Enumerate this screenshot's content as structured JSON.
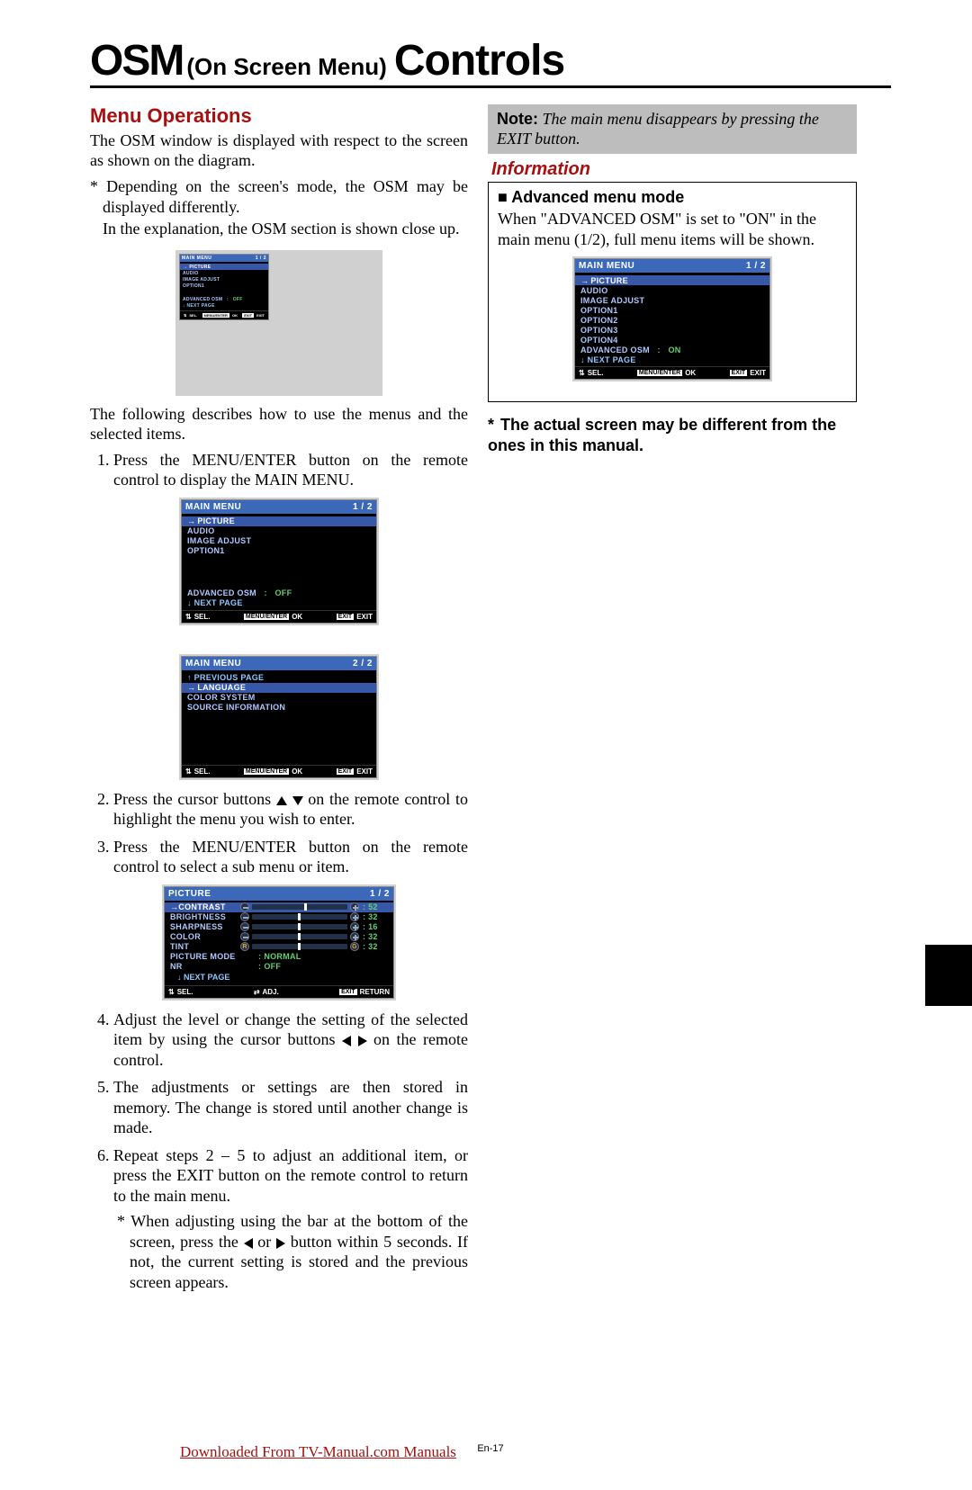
{
  "header": {
    "osm": "OSM",
    "sub": "(On Screen Menu)",
    "controls": "Controls"
  },
  "left": {
    "menu_ops_h": "Menu Operations",
    "intro": "The OSM window is displayed with respect to the screen as shown on the diagram.",
    "asterisk1": "Depending on the screen's mode, the OSM may be displayed differently.",
    "asterisk1b": "In the explanation, the OSM section is shown close up.",
    "after_small": "The following describes how to use the menus and the selected items.",
    "step1": "Press the MENU/ENTER button on the remote control to display the MAIN MENU.",
    "step2": "Press the cursor buttons ▲ ▼ on the remote control to highlight the menu you wish to enter.",
    "step3": "Press the MENU/ENTER button on the remote control to select a sub menu or item.",
    "step4": "Adjust the level or change the setting of the selected item by using the cursor buttons ◀ ▶ on the remote control.",
    "step5": "The adjustments or settings are then stored in memory. The change is stored until another change is made.",
    "step6": "Repeat steps 2 – 5 to adjust an additional item, or press the EXIT button on the remote control to return to the main menu.",
    "substep": "When adjusting using the bar at the bottom of the screen, press the ◀ or ▶ button within 5 seconds. If not, the current setting is stored and the previous screen appears."
  },
  "right": {
    "note_label": "Note:",
    "note_text": " The main menu disappears by pressing the EXIT button.",
    "info_h": "Information",
    "adv_h": "Advanced menu mode",
    "adv_body": "When \"ADVANCED OSM\" is set to \"ON\" in the main menu (1/2), full menu items will be shown.",
    "actual_note": "The actual screen may be different from the ones in this manual."
  },
  "osm_main_1": {
    "title": "MAIN MENU",
    "page": "1 / 2",
    "items": [
      "PICTURE",
      "AUDIO",
      "IMAGE ADJUST",
      "OPTION1"
    ],
    "adv": "ADVANCED OSM",
    "adv_val": "OFF",
    "next": "↓ NEXT PAGE",
    "f_sel": "SEL.",
    "f_ok": "OK",
    "f_okbtn": "MENU/ENTER",
    "f_ex": "EXIT",
    "f_exbtn": "EXIT"
  },
  "osm_main_2": {
    "title": "MAIN MENU",
    "page": "2 / 2",
    "prev": "↑ PREVIOUS PAGE",
    "items": [
      "LANGUAGE",
      "COLOR SYSTEM",
      "SOURCE INFORMATION"
    ],
    "f_sel": "SEL.",
    "f_ok": "OK",
    "f_okbtn": "MENU/ENTER",
    "f_ex": "EXIT",
    "f_exbtn": "EXIT"
  },
  "osm_adv": {
    "title": "MAIN MENU",
    "page": "1 / 2",
    "items": [
      "PICTURE",
      "AUDIO",
      "IMAGE ADJUST",
      "OPTION1",
      "OPTION2",
      "OPTION3",
      "OPTION4"
    ],
    "adv": "ADVANCED OSM",
    "adv_val": "ON",
    "next": "↓ NEXT PAGE",
    "f_sel": "SEL.",
    "f_ok": "OK",
    "f_okbtn": "MENU/ENTER",
    "f_ex": "EXIT",
    "f_exbtn": "EXIT"
  },
  "osm_picture": {
    "title": "PICTURE",
    "page": "1 / 2",
    "rows": [
      {
        "label": "CONTRAST",
        "type": "slider",
        "val": "52",
        "pos": 55,
        "sel": true
      },
      {
        "label": "BRIGHTNESS",
        "type": "slider",
        "val": "32",
        "pos": 48
      },
      {
        "label": "SHARPNESS",
        "type": "slider",
        "val": "16",
        "pos": 48
      },
      {
        "label": "COLOR",
        "type": "slider",
        "val": "32",
        "pos": 48
      },
      {
        "label": "TINT",
        "type": "tint",
        "val": "32",
        "pos": 48
      },
      {
        "label": "PICTURE MODE",
        "type": "kv",
        "val": "NORMAL"
      },
      {
        "label": "NR",
        "type": "kv",
        "val": "OFF"
      }
    ],
    "next": "↓ NEXT PAGE",
    "f_sel": "SEL.",
    "f_adj": "ADJ.",
    "f_ret": "RETURN",
    "f_exbtn": "EXIT"
  },
  "footer": {
    "download": "Downloaded From TV-Manual.com Manuals",
    "pg": "En-17"
  }
}
